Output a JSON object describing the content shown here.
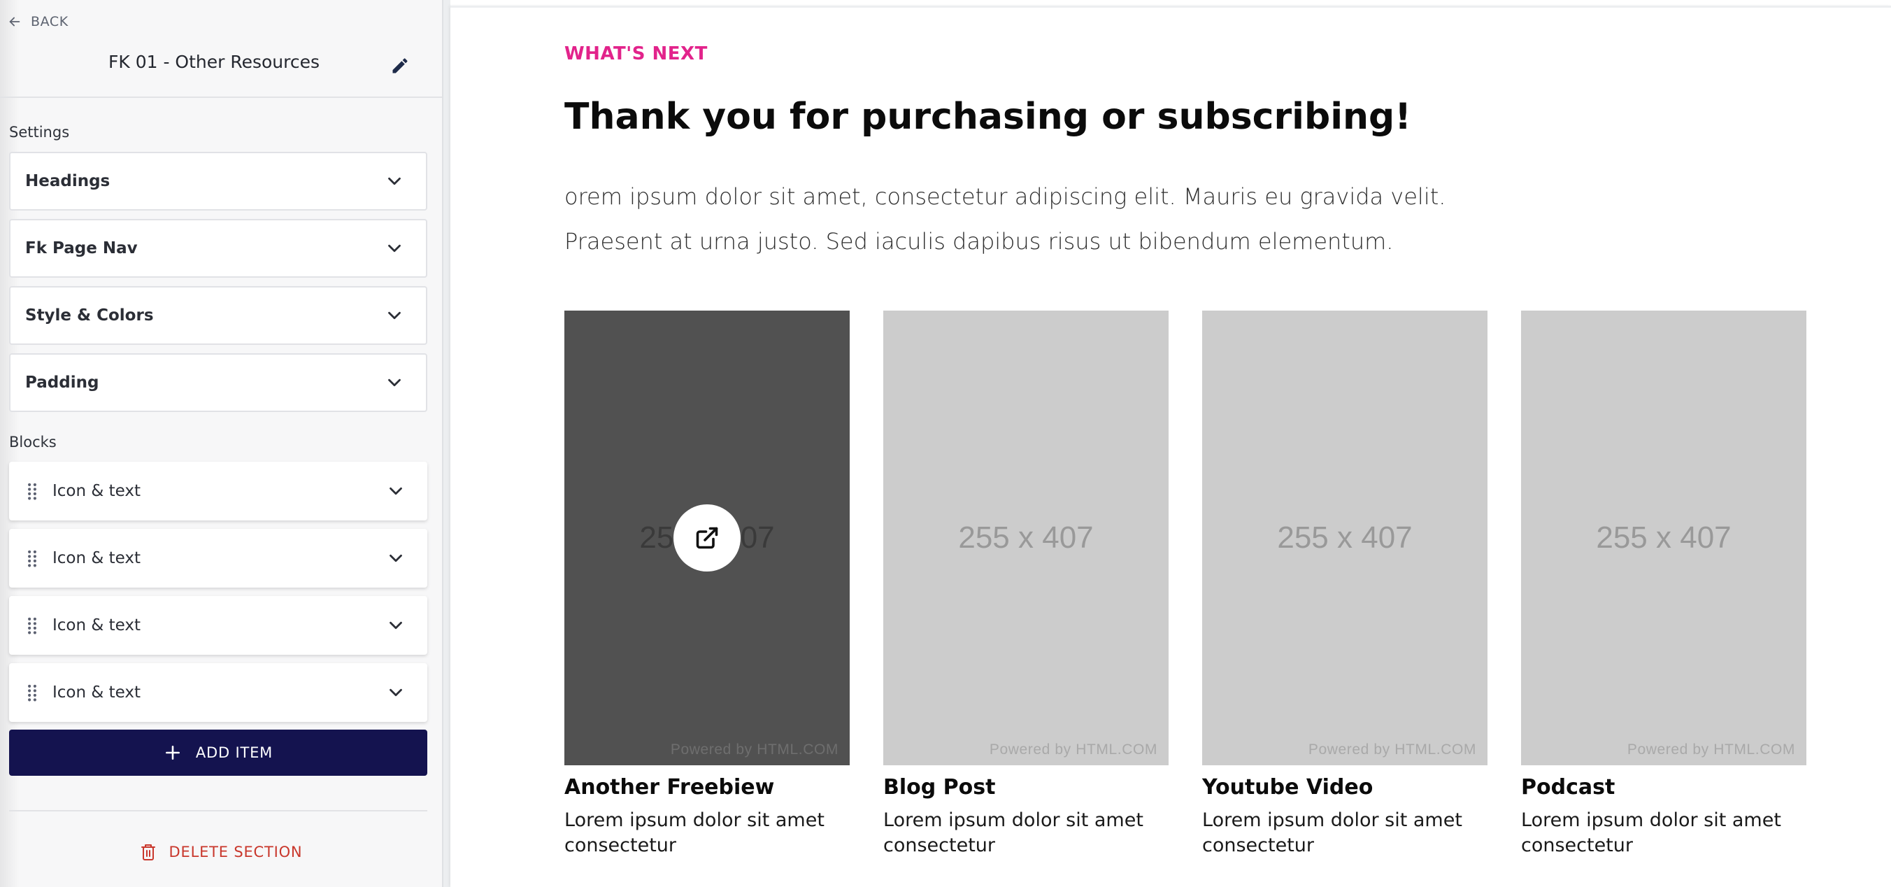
{
  "sidebar": {
    "back_label": "BACK",
    "section_title": "FK 01 - Other Resources",
    "settings_label": "Settings",
    "settings": [
      {
        "label": "Headings"
      },
      {
        "label": "Fk Page Nav"
      },
      {
        "label": "Style & Colors"
      },
      {
        "label": "Padding"
      }
    ],
    "blocks_label": "Blocks",
    "blocks": [
      {
        "label": "Icon & text"
      },
      {
        "label": "Icon & text"
      },
      {
        "label": "Icon & text"
      },
      {
        "label": "Icon & text"
      }
    ],
    "add_item_label": "ADD ITEM",
    "delete_label": "DELETE SECTION"
  },
  "preview": {
    "eyebrow": "WHAT'S NEXT",
    "headline": "Thank you for purchasing or subscribing!",
    "intro_line1": "orem ipsum dolor sit amet, consectetur adipiscing elit. Mauris eu gravida velit.",
    "intro_line2": "Praesent at urna justo. Sed iaculis dapibus risus ut bibendum elementum.",
    "cards": [
      {
        "placeholder": "255 x 407",
        "powered": "Powered by HTML.COM",
        "title": "Another Freebiew",
        "text": "Lorem ipsum dolor sit amet consectetur",
        "hovered": true
      },
      {
        "placeholder": "255 x 407",
        "powered": "Powered by HTML.COM",
        "title": "Blog Post",
        "text": "Lorem ipsum dolor sit amet consectetur",
        "hovered": false
      },
      {
        "placeholder": "255 x 407",
        "powered": "Powered by HTML.COM",
        "title": "Youtube Video",
        "text": "Lorem ipsum dolor sit amet consectetur",
        "hovered": false
      },
      {
        "placeholder": "255 x 407",
        "powered": "Powered by HTML.COM",
        "title": "Podcast",
        "text": "Lorem ipsum dolor sit amet consectetur",
        "hovered": false
      }
    ]
  },
  "colors": {
    "accent_pink": "#e2238b",
    "add_button_bg": "#14134f",
    "delete_red": "#c9372c",
    "placeholder_gray": "#cccccc",
    "placeholder_hover": "#515151"
  },
  "icons": [
    "arrow-left-icon",
    "pencil-icon",
    "chevron-down-icon",
    "drag-handle-icon",
    "plus-icon",
    "trash-icon",
    "external-link-icon"
  ]
}
